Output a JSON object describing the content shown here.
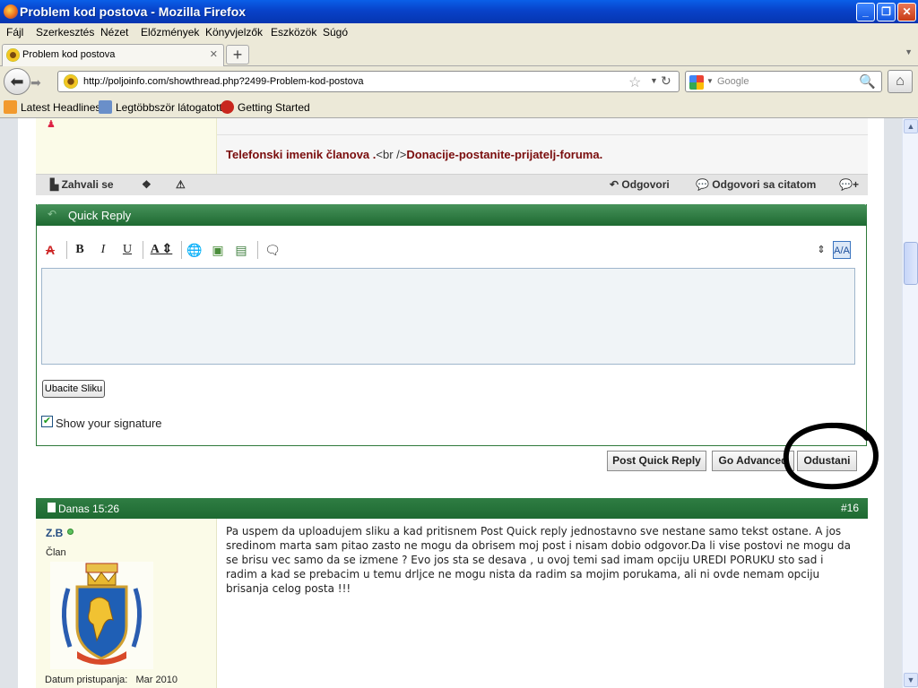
{
  "window": {
    "title": "Problem kod postova - Mozilla Firefox"
  },
  "menu": {
    "items": [
      "Fájl",
      "Szerkesztés",
      "Nézet",
      "Előzmények",
      "Könyvjelzők",
      "Eszközök",
      "Súgó"
    ]
  },
  "tab": {
    "label": "Problem kod postova"
  },
  "nav": {
    "url": "http://poljoinfo.com/showthread.php?2499-Problem-kod-postova",
    "search_placeholder": "Google"
  },
  "bookmarks": [
    "Latest Headlines",
    "Legtöbbször látogatott",
    "Getting Started"
  ],
  "prev_post": {
    "signature_links": [
      "Telefonski imenik članova .",
      "<br />",
      "Donacije-postanite-prijatelj-foruma."
    ]
  },
  "actions": {
    "thanks": "Zahvali se",
    "reply": "Odgovori",
    "reply_quote": "Odgovori sa citatom"
  },
  "quick_reply": {
    "title": "Quick Reply",
    "upload_label": "Ubacite Sliku",
    "signature_label": "Show your signature",
    "signature_checked": true,
    "buttons": {
      "post": "Post Quick Reply",
      "advanced": "Go Advanced",
      "cancel": "Odustani"
    }
  },
  "post": {
    "date": "Danas 15:26",
    "number": "#16",
    "username": "Z.B",
    "rank": "Član",
    "join_label": "Datum pristupanja:",
    "join_date": "Mar 2010",
    "text": "Pa uspem da uploadujem sliku a kad pritisnem Post Quick reply jednostavno sve nestane samo tekst ostane. A jos sredinom marta sam pitao zasto ne mogu da obrisem moj post i nisam dobio odgovor.Da li vise postovi ne mogu da se brisu vec samo da se izmene ? Evo jos sta se desava , u ovoj temi sad imam opciju UREDI PORUKU sto sad i radim a kad se prebacim u temu drljce ne mogu nista da radim sa mojim porukama, ali ni ovde nemam opciju brisanja celog posta !!!"
  },
  "colors": {
    "forum_green": "#1e6a32",
    "sig_red": "#7a0d0d",
    "user_bg": "#fbfbe8",
    "xp_blue": "#0842c9"
  }
}
